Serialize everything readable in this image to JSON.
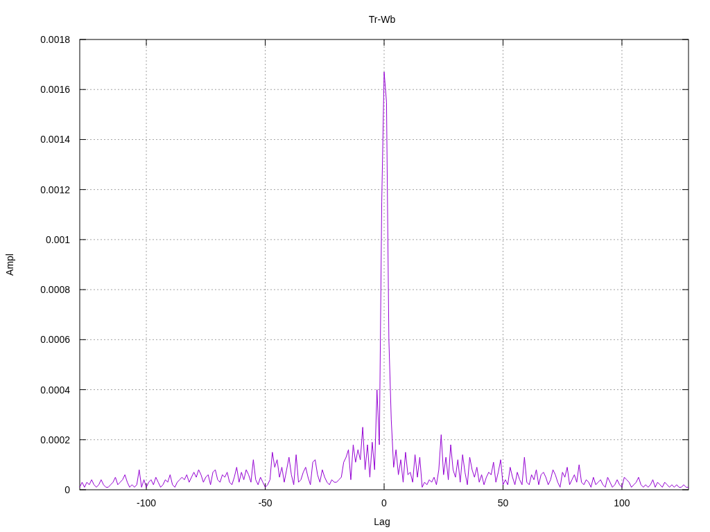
{
  "chart_data": {
    "type": "line",
    "title": "Tr-Wb",
    "xlabel": "Lag",
    "ylabel": "Ampl",
    "xlim": [
      -128,
      128
    ],
    "ylim": [
      0,
      0.0018
    ],
    "xticks": [
      -100,
      -50,
      0,
      50,
      100
    ],
    "grid": true,
    "x": [
      -128,
      -127,
      -126,
      -125,
      -124,
      -123,
      -122,
      -121,
      -120,
      -119,
      -118,
      -117,
      -116,
      -115,
      -114,
      -113,
      -112,
      -111,
      -110,
      -109,
      -108,
      -107,
      -106,
      -105,
      -104,
      -103,
      -102,
      -101,
      -100,
      -99,
      -98,
      -97,
      -96,
      -95,
      -94,
      -93,
      -92,
      -91,
      -90,
      -89,
      -88,
      -87,
      -86,
      -85,
      -84,
      -83,
      -82,
      -81,
      -80,
      -79,
      -78,
      -77,
      -76,
      -75,
      -74,
      -73,
      -72,
      -71,
      -70,
      -69,
      -68,
      -67,
      -66,
      -65,
      -64,
      -63,
      -62,
      -61,
      -60,
      -59,
      -58,
      -57,
      -56,
      -55,
      -54,
      -53,
      -52,
      -51,
      -50,
      -49,
      -48,
      -47,
      -46,
      -45,
      -44,
      -43,
      -42,
      -41,
      -40,
      -39,
      -38,
      -37,
      -36,
      -35,
      -34,
      -33,
      -32,
      -31,
      -30,
      -29,
      -28,
      -27,
      -26,
      -25,
      -24,
      -23,
      -22,
      -21,
      -20,
      -19,
      -18,
      -17,
      -16,
      -15,
      -14,
      -13,
      -12,
      -11,
      -10,
      -9,
      -8,
      -7,
      -6,
      -5,
      -4,
      -3,
      -2,
      -1,
      0,
      1,
      2,
      3,
      4,
      5,
      6,
      7,
      8,
      9,
      10,
      11,
      12,
      13,
      14,
      15,
      16,
      17,
      18,
      19,
      20,
      21,
      22,
      23,
      24,
      25,
      26,
      27,
      28,
      29,
      30,
      31,
      32,
      33,
      34,
      35,
      36,
      37,
      38,
      39,
      40,
      41,
      42,
      43,
      44,
      45,
      46,
      47,
      48,
      49,
      50,
      51,
      52,
      53,
      54,
      55,
      56,
      57,
      58,
      59,
      60,
      61,
      62,
      63,
      64,
      65,
      66,
      67,
      68,
      69,
      70,
      71,
      72,
      73,
      74,
      75,
      76,
      77,
      78,
      79,
      80,
      81,
      82,
      83,
      84,
      85,
      86,
      87,
      88,
      89,
      90,
      91,
      92,
      93,
      94,
      95,
      96,
      97,
      98,
      99,
      100,
      101,
      102,
      103,
      104,
      105,
      106,
      107,
      108,
      109,
      110,
      111,
      112,
      113,
      114,
      115,
      116,
      117,
      118,
      119,
      120,
      121,
      122,
      123,
      124,
      125,
      126,
      127,
      128
    ],
    "yticks": [
      {
        "value": 0,
        "label": "0"
      },
      {
        "value": 0.0002,
        "label": "0.0002"
      },
      {
        "value": 0.0004,
        "label": "0.0004"
      },
      {
        "value": 0.0006,
        "label": "0.0006"
      },
      {
        "value": 0.0008,
        "label": "0.0008"
      },
      {
        "value": 0.001,
        "label": "0.001"
      },
      {
        "value": 0.0012,
        "label": "0.0012"
      },
      {
        "value": 0.0014,
        "label": "0.0014"
      },
      {
        "value": 0.0016,
        "label": "0.0016"
      },
      {
        "value": 0.0018,
        "label": "0.0018"
      }
    ],
    "series": [
      {
        "color": "#9400d3",
        "values": [
          1e-05,
          3e-05,
          1e-05,
          3e-05,
          2e-05,
          4e-05,
          2e-05,
          1e-05,
          2e-05,
          4e-05,
          2e-05,
          1e-05,
          1e-05,
          2e-05,
          3e-05,
          5e-05,
          2e-05,
          3e-05,
          4e-05,
          6e-05,
          3e-05,
          1e-05,
          2e-05,
          1e-05,
          2e-05,
          8e-05,
          1e-05,
          4e-05,
          1e-05,
          3e-05,
          4e-05,
          2e-05,
          5e-05,
          3e-05,
          1e-05,
          2e-05,
          4e-05,
          3e-05,
          6e-05,
          2e-05,
          1e-05,
          3e-05,
          4e-05,
          5e-05,
          4e-05,
          6e-05,
          3e-05,
          5e-05,
          7e-05,
          5e-05,
          8e-05,
          6e-05,
          3e-05,
          5e-05,
          6e-05,
          2e-05,
          7e-05,
          8e-05,
          4e-05,
          3e-05,
          6e-05,
          5e-05,
          7e-05,
          3e-05,
          2e-05,
          5e-05,
          9e-05,
          3e-05,
          7e-05,
          4e-05,
          8e-05,
          6e-05,
          3e-05,
          0.00012,
          4e-05,
          2e-05,
          5e-05,
          3e-05,
          1e-05,
          2e-05,
          4e-05,
          0.00015,
          9e-05,
          0.00012,
          5e-05,
          9e-05,
          3e-05,
          8e-05,
          0.00013,
          6e-05,
          2e-05,
          0.00014,
          3e-05,
          4e-05,
          7e-05,
          9e-05,
          5e-05,
          2e-05,
          0.00011,
          0.00012,
          6e-05,
          3e-05,
          8e-05,
          5e-05,
          3e-05,
          2e-05,
          4e-05,
          3e-05,
          3e-05,
          4e-05,
          5e-05,
          0.00011,
          0.00013,
          0.00016,
          4e-05,
          0.00018,
          0.00011,
          0.00016,
          0.00012,
          0.00025,
          8e-05,
          0.00018,
          5e-05,
          0.00019,
          8e-05,
          0.0004,
          0.00018,
          0.00115,
          0.00167,
          0.00155,
          0.0006,
          0.00028,
          9e-05,
          0.00016,
          6e-05,
          0.00012,
          3e-05,
          0.00015,
          6e-05,
          7e-05,
          3e-05,
          0.00014,
          5e-05,
          0.00013,
          1e-05,
          3e-05,
          2e-05,
          4e-05,
          3e-05,
          5e-05,
          2e-05,
          8e-05,
          0.00022,
          6e-05,
          0.00013,
          4e-05,
          0.00018,
          8e-05,
          5e-05,
          0.00012,
          3e-05,
          0.00014,
          7e-05,
          2e-05,
          0.00013,
          8e-05,
          5e-05,
          9e-05,
          3e-05,
          6e-05,
          2e-05,
          5e-05,
          7e-05,
          6e-05,
          0.00011,
          3e-05,
          7e-05,
          0.00012,
          2e-05,
          4e-05,
          2e-05,
          9e-05,
          5e-05,
          2e-05,
          7e-05,
          4e-05,
          2e-05,
          0.00013,
          3e-05,
          2e-05,
          6e-05,
          4e-05,
          8e-05,
          2e-05,
          6e-05,
          7e-05,
          5e-05,
          2e-05,
          4e-05,
          8e-05,
          6e-05,
          3e-05,
          1e-05,
          7e-05,
          5e-05,
          9e-05,
          2e-05,
          4e-05,
          6e-05,
          3e-05,
          0.0001,
          3e-05,
          2e-05,
          4e-05,
          3e-05,
          1e-05,
          5e-05,
          2e-05,
          3e-05,
          4e-05,
          2e-05,
          1e-05,
          5e-05,
          3e-05,
          1e-05,
          2e-05,
          4e-05,
          2e-05,
          1e-05,
          5e-05,
          4e-05,
          3e-05,
          1e-05,
          2e-05,
          3e-05,
          5e-05,
          2e-05,
          1e-05,
          2e-05,
          1e-05,
          2e-05,
          4e-05,
          1e-05,
          3e-05,
          2e-05,
          1e-05,
          3e-05,
          2e-05,
          1e-05,
          2e-05,
          1e-05,
          2e-05,
          1e-05,
          1e-05,
          2e-05,
          1e-05,
          1e-05
        ]
      }
    ]
  }
}
